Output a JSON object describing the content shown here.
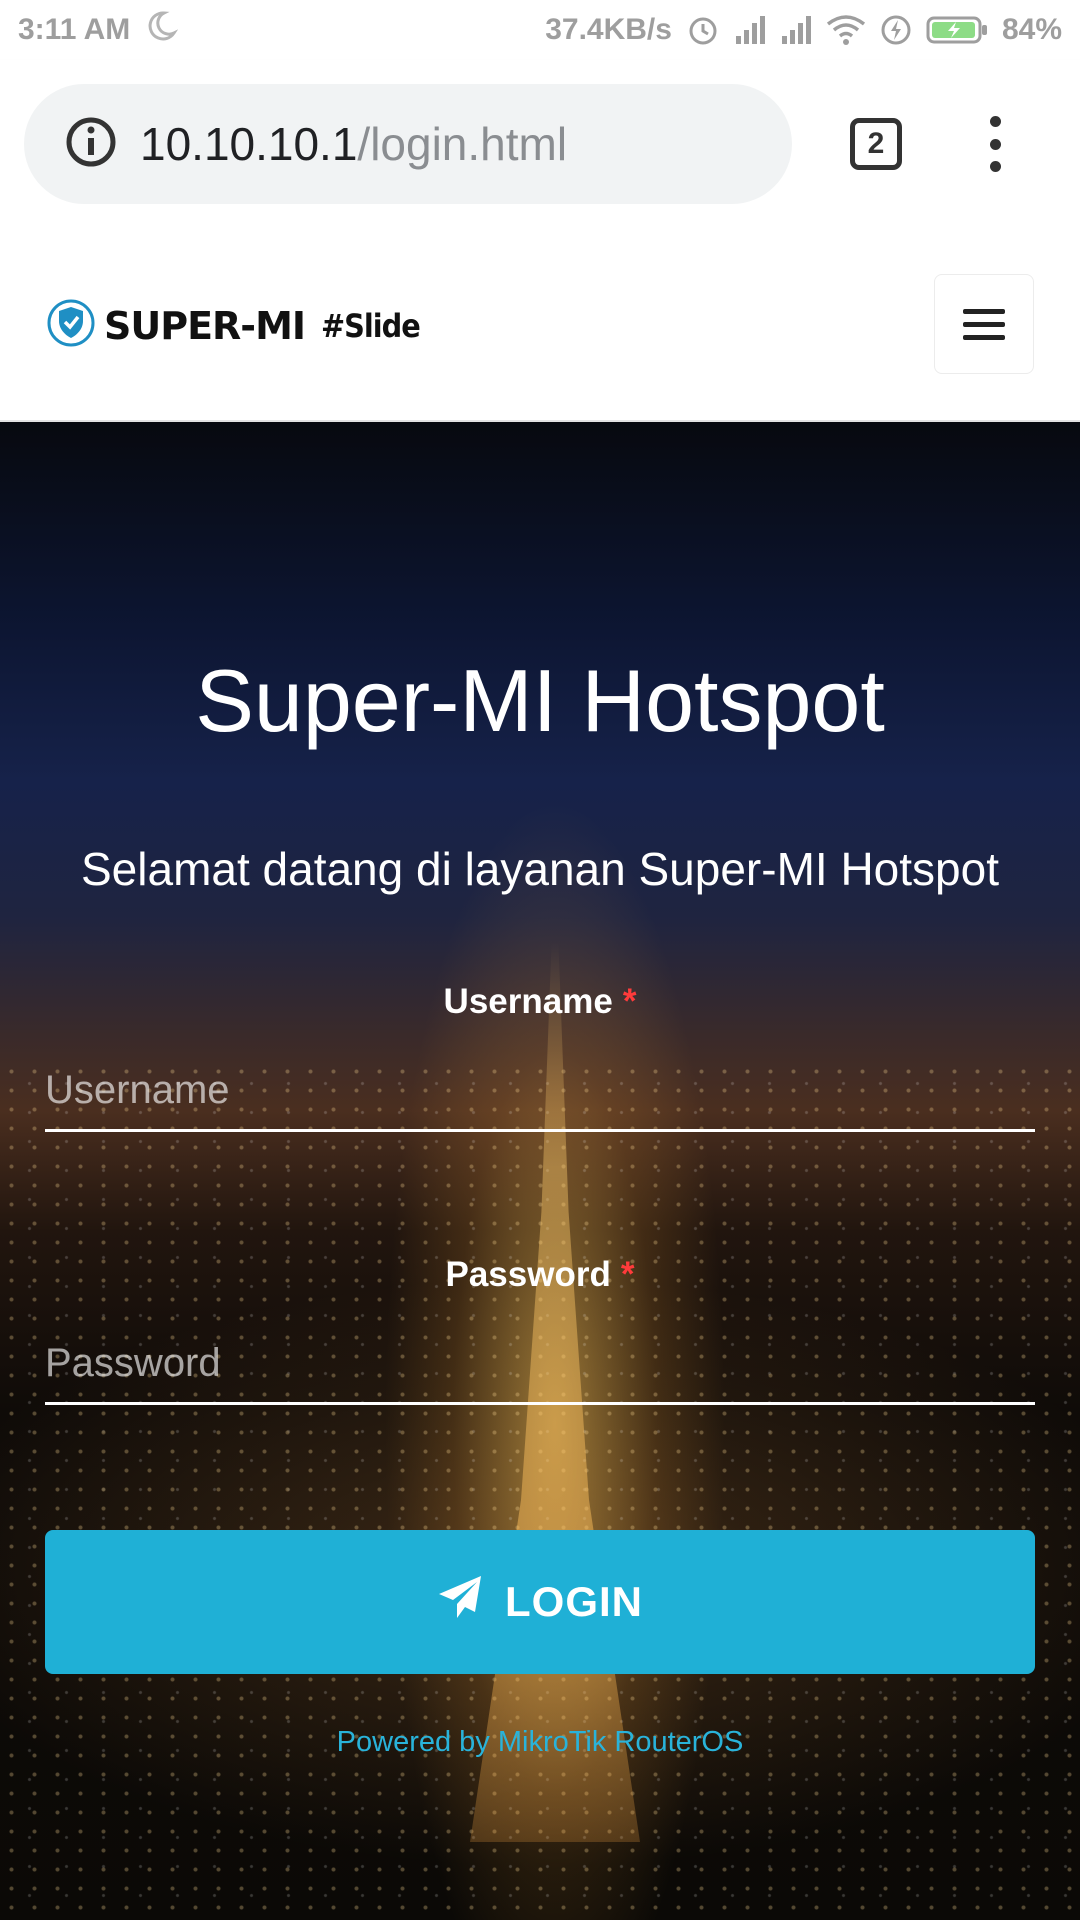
{
  "status_bar": {
    "time": "3:11 AM",
    "network_speed": "37.4KB/s",
    "battery": "84%",
    "icons": [
      "moon-icon",
      "alarm-icon",
      "signal-icon",
      "signal-icon",
      "wifi-icon",
      "charging-icon",
      "battery-icon"
    ]
  },
  "browser": {
    "url_host": "10.10.10.1",
    "url_path": "/login.html",
    "tab_count": "2",
    "icons": [
      "info-icon",
      "tabs-icon",
      "overflow-menu-icon"
    ]
  },
  "navbar": {
    "brand_name": "SUPER-MI",
    "brand_tag": "#Slide",
    "icons": [
      "shield-check-icon",
      "hamburger-menu-icon"
    ]
  },
  "hero": {
    "title": "Super-MI Hotspot",
    "subtitle": "Selamat datang di layanan Super-MI Hotspot"
  },
  "form": {
    "username_label": "Username",
    "username_placeholder": "Username",
    "password_label": "Password",
    "password_placeholder": "Password",
    "required_mark": "*",
    "login_label": "LOGIN",
    "login_icon": "paper-plane-icon"
  },
  "footer": {
    "powered_by": "Powered by MikroTik RouterOS"
  },
  "colors": {
    "accent": "#1fb0d6",
    "link": "#29b3da",
    "required": "#ff3b3b"
  }
}
